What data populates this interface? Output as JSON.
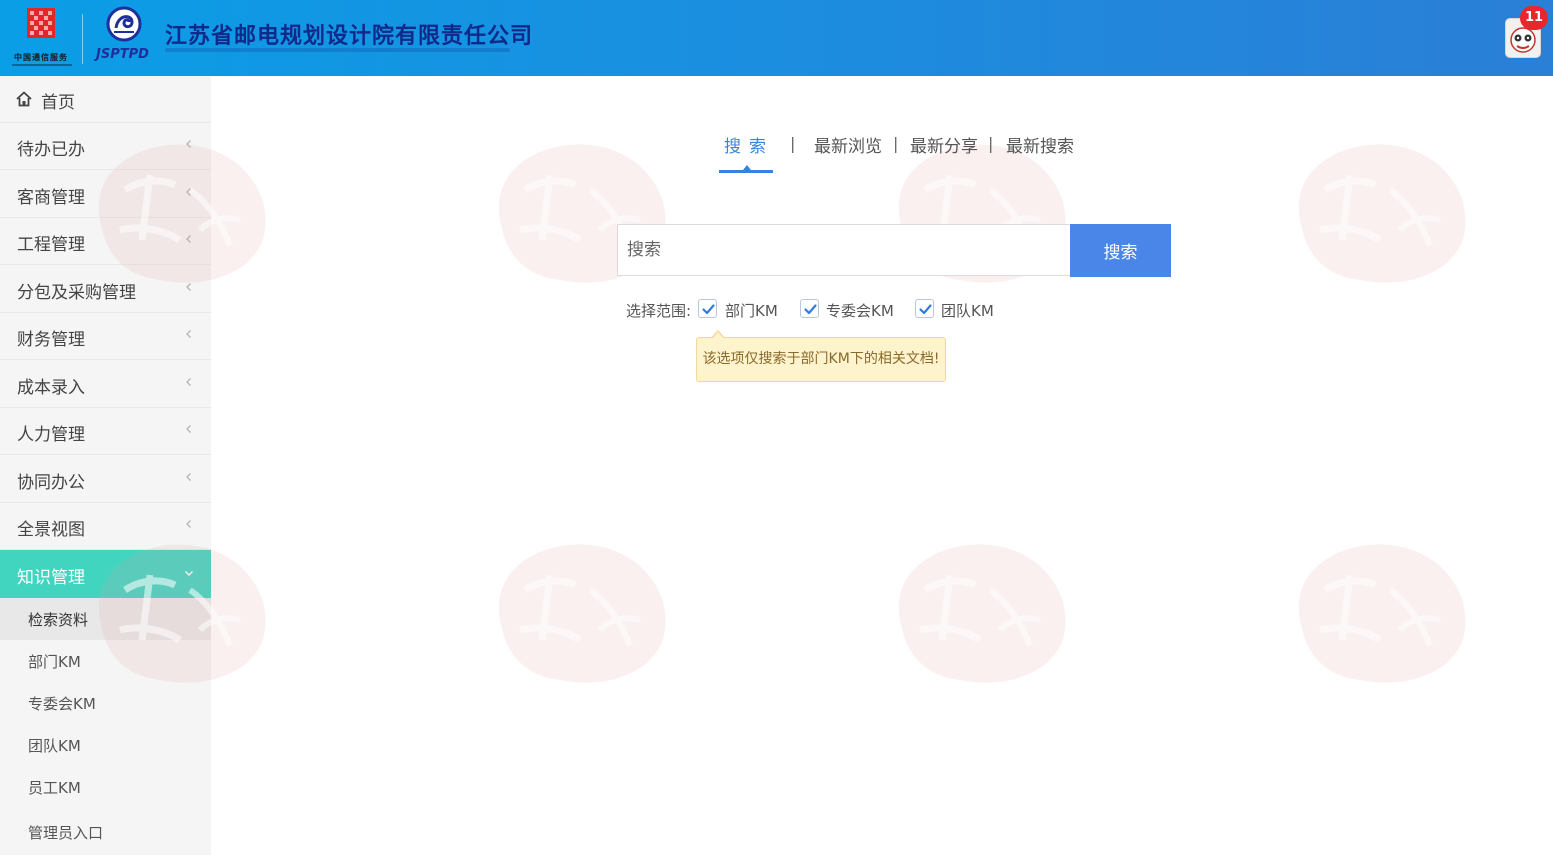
{
  "header": {
    "company_name": "江苏省邮电规划设计院有限责任公司",
    "logo_left_text": "中国通信服务",
    "logo_right_text": "JSPTPD",
    "notification_count": "11"
  },
  "sidebar": {
    "items": [
      {
        "label": "首页",
        "icon": "home-icon"
      },
      {
        "label": "待办已办"
      },
      {
        "label": "客商管理"
      },
      {
        "label": "工程管理"
      },
      {
        "label": "分包及采购管理"
      },
      {
        "label": "财务管理"
      },
      {
        "label": "成本录入"
      },
      {
        "label": "人力管理"
      },
      {
        "label": "协同办公"
      },
      {
        "label": "全景视图"
      },
      {
        "label": "知识管理",
        "expanded": true
      }
    ],
    "sub_items": [
      {
        "label": "检索资料",
        "current": true
      },
      {
        "label": "部门KM"
      },
      {
        "label": "专委会KM"
      },
      {
        "label": "团队KM"
      },
      {
        "label": "员工KM"
      },
      {
        "label": "管理员入口"
      }
    ]
  },
  "main": {
    "tabs": [
      {
        "label": "搜索",
        "active": true
      },
      {
        "label": "最新浏览"
      },
      {
        "label": "最新分享"
      },
      {
        "label": "最新搜索"
      }
    ],
    "tab_separator": "|",
    "search": {
      "placeholder": "搜索",
      "value": "",
      "button_label": "搜索"
    },
    "scope": {
      "label": "选择范围:",
      "options": [
        {
          "label": "部门KM",
          "checked": true
        },
        {
          "label": "专委会KM",
          "checked": true
        },
        {
          "label": "团队KM",
          "checked": true
        }
      ]
    },
    "tooltip": "该选项仅搜索于部门KM下的相关文档!"
  },
  "colors": {
    "header_blue": "#1a8fe0",
    "active_menu": "#41d5c0",
    "primary_button": "#4a86e8",
    "tab_active": "#3a82e0",
    "tooltip_bg": "#fdf3cd",
    "badge_red": "#e9262e"
  }
}
